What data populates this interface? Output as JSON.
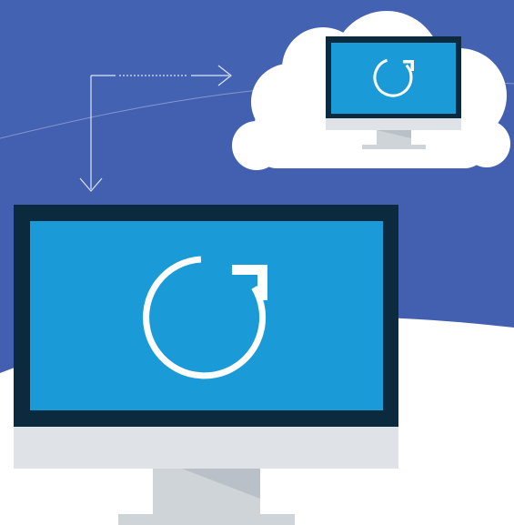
{
  "illustration": {
    "colors": {
      "background": "#4360b0",
      "background_shadow": "#3e5aa8",
      "ground": "#ffffff",
      "cloud": "#ffffff",
      "monitor_frame": "#0c2a3e",
      "monitor_screen": "#1a9bd7",
      "monitor_chin": "#dfe3e7",
      "stand": "#cfd4d9",
      "stand_shade": "#b9c0c7",
      "refresh_icon": "#ffffff",
      "connector_line": "#dbe4f7"
    },
    "icons": {
      "large_monitor": "desktop-monitor-icon",
      "small_monitor": "cloud-monitor-icon",
      "refresh": "refresh-icon",
      "cloud": "cloud-icon",
      "arrow_right": "arrow-right-icon",
      "arrow_down": "arrow-down-icon"
    }
  }
}
